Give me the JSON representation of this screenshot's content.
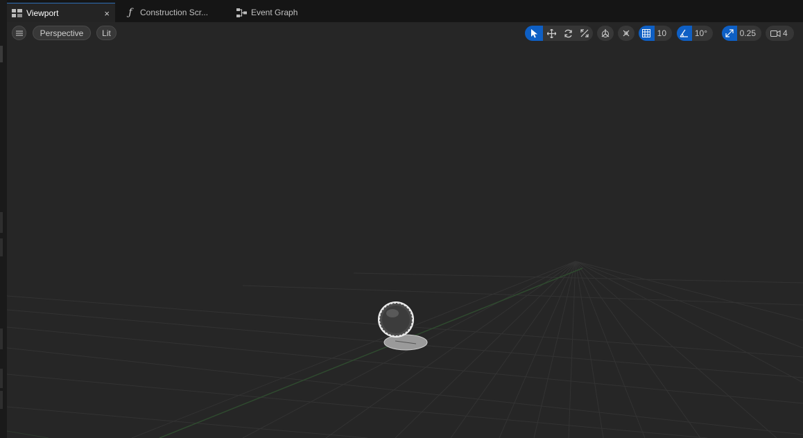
{
  "tabs": [
    {
      "label": "Viewport",
      "close": "×",
      "icon": "viewport-grid-icon"
    },
    {
      "label": "Construction Scr...",
      "icon": "function-icon"
    },
    {
      "label": "Event Graph",
      "icon": "event-graph-icon"
    }
  ],
  "viewport_toolbar": {
    "menu_icon": "hamburger-icon",
    "view_mode": "Perspective",
    "lighting_mode": "Lit",
    "grid_snap_value": "10",
    "rotation_snap_value": "10°",
    "scale_snap_value": "0.25",
    "camera_speed_value": "4"
  },
  "colors": {
    "accent": "#0e5fc4",
    "viewport_bg": "#262626",
    "tab_active_border": "#2d6fb8"
  }
}
